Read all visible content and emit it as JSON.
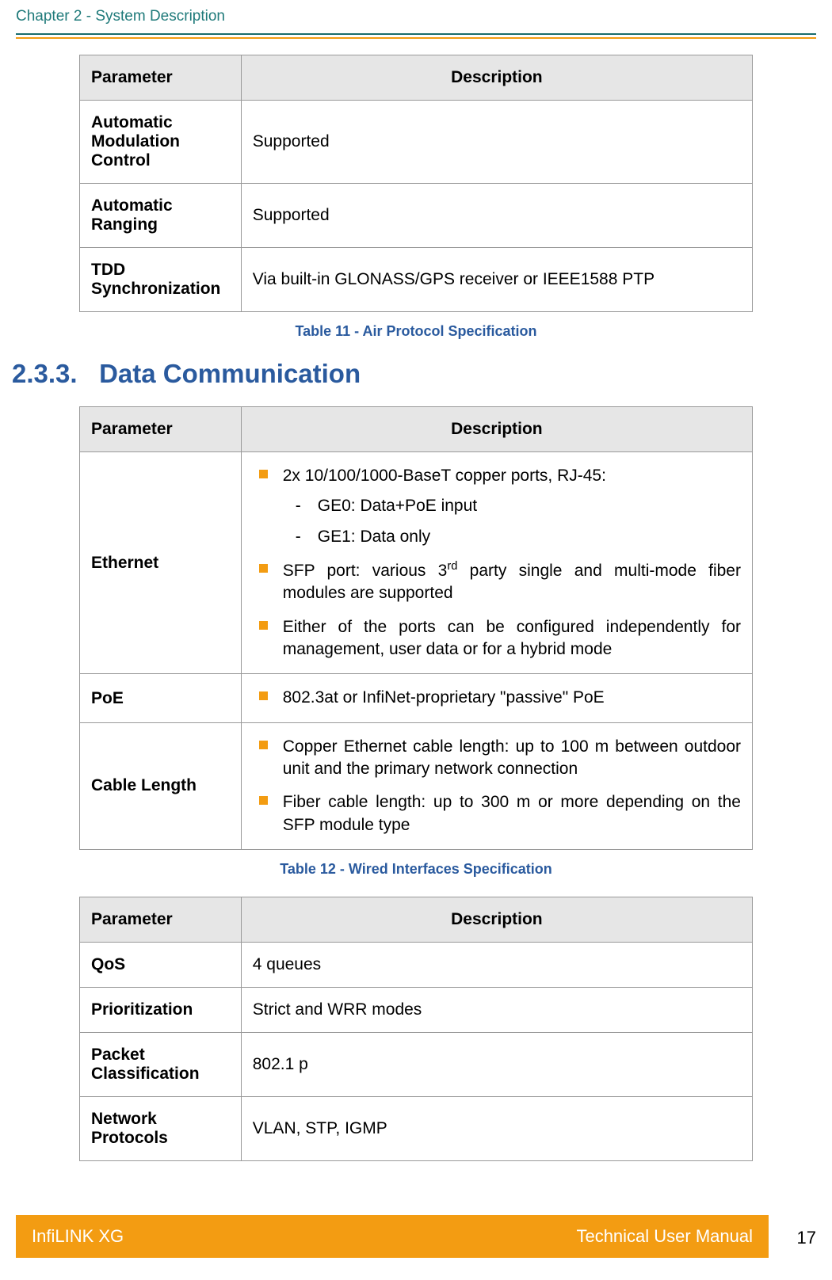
{
  "header": {
    "chapter": "Chapter 2 - System Description"
  },
  "table11": {
    "headers": {
      "param": "Parameter",
      "desc": "Description"
    },
    "rows": [
      {
        "param": "Automatic Modulation Control",
        "desc": "Supported"
      },
      {
        "param": "Automatic Ranging",
        "desc": "Supported"
      },
      {
        "param": "TDD Synchronization",
        "desc": "Via built-in GLONASS/GPS receiver or IEEE1588 PTP"
      }
    ],
    "caption": "Table 11 - Air Protocol Specification"
  },
  "section": {
    "number": "2.3.3.",
    "title": "Data Communication"
  },
  "table12": {
    "headers": {
      "param": "Parameter",
      "desc": "Description"
    },
    "rows": {
      "ethernet": {
        "param": "Ethernet",
        "bullets": {
          "b0": "2x 10/100/1000-BaseT copper ports, RJ-45:",
          "b0_sub0": "GE0: Data+PoE input",
          "b0_sub1": "GE1: Data only",
          "b1_pre": "SFP port: various 3",
          "b1_sup": "rd",
          "b1_post": " party single and multi-mode fiber modules are supported",
          "b2": "Either of the ports can be configured independently for management, user data or for a hybrid mode"
        }
      },
      "poe": {
        "param": "PoE",
        "bullets": {
          "b0": "802.3at or InfiNet-proprietary \"passive\" PoE"
        }
      },
      "cable": {
        "param": "Cable Length",
        "bullets": {
          "b0": "Copper Ethernet cable length: up to 100 m between outdoor unit and the primary network connection",
          "b1": "Fiber cable length: up to 300 m or more depending on the SFP module type"
        }
      }
    },
    "caption": "Table 12 - Wired Interfaces Specification"
  },
  "table13": {
    "headers": {
      "param": "Parameter",
      "desc": "Description"
    },
    "rows": [
      {
        "param": "QoS",
        "desc": "4 queues"
      },
      {
        "param": "Prioritization",
        "desc": "Strict and WRR modes"
      },
      {
        "param": "Packet Classification",
        "desc": "802.1 p"
      },
      {
        "param": "Network Protocols",
        "desc": "VLAN, STP, IGMP"
      }
    ]
  },
  "footer": {
    "product": "InfiLINK XG",
    "doc": "Technical User Manual",
    "page": "17"
  }
}
